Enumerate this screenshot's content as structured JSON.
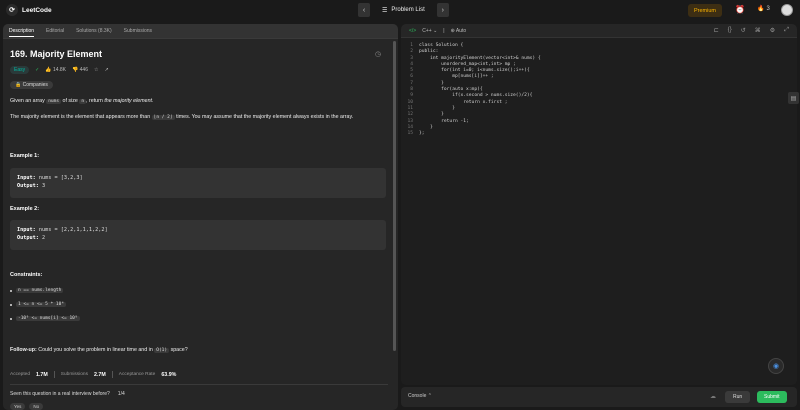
{
  "header": {
    "logo": "LeetCode",
    "problem_list": "Problem List",
    "premium": "Premium",
    "streak": "3"
  },
  "tabs": [
    "Description",
    "Editorial",
    "Solutions (8.3K)",
    "Submissions"
  ],
  "problem": {
    "title": "169. Majority Element",
    "difficulty": "Easy",
    "likes": "14.8K",
    "dislikes": "446",
    "companies": "Companies",
    "desc_1a": "Given an array ",
    "desc_1_code1": "nums",
    "desc_1b": " of size ",
    "desc_1_code2": "n",
    "desc_1c": ", return ",
    "desc_1_em": "the majority element",
    "desc_1d": ".",
    "desc_2a": "The majority element is the element that appears more than ",
    "desc_2_code": "⌊n / 2⌋",
    "desc_2b": " times. You may assume that the majority element always exists in the array.",
    "example1_title": "Example 1:",
    "example1_input_label": "Input:",
    "example1_input": "nums = [3,2,3]",
    "example1_output_label": "Output:",
    "example1_output": "3",
    "example2_title": "Example 2:",
    "example2_input_label": "Input:",
    "example2_input": "nums = [2,2,1,1,1,2,2]",
    "example2_output_label": "Output:",
    "example2_output": "2",
    "constraints_title": "Constraints:",
    "constraints": [
      "n == nums.length",
      "1 <= n <= 5 * 10⁴",
      "-10⁹ <= nums[i] <= 10⁹"
    ],
    "followup_label": "Follow-up:",
    "followup_text": " Could you solve the problem in linear time and in ",
    "followup_code": "O(1)",
    "followup_end": " space?",
    "accepted_label": "Accepted",
    "accepted_value": "1.7M",
    "submissions_label": "Submissions",
    "submissions_value": "2.7M",
    "rate_label": "Acceptance Rate",
    "rate_value": "63.9%",
    "seen_text": "Seen this question in a real interview before?",
    "seen_count": "1/4",
    "yes": "Yes",
    "no": "No"
  },
  "editor": {
    "language": "C++",
    "mode": "Auto",
    "lines": [
      "class Solution {",
      "public:",
      "    int majorityElement(vector<int>& nums) {",
      "        unordered_map<int,int> mp ;",
      "        for(int i=0; i<nums.size();i++){",
      "            mp[nums[i]]++ ;",
      "        }",
      "        for(auto x:mp){",
      "            if(x.second > nums.size()/2){",
      "                return x.first ;",
      "            }",
      "        }",
      "        return -1;",
      "    }",
      "};"
    ]
  },
  "footer": {
    "console": "Console",
    "run": "Run",
    "submit": "Submit"
  }
}
